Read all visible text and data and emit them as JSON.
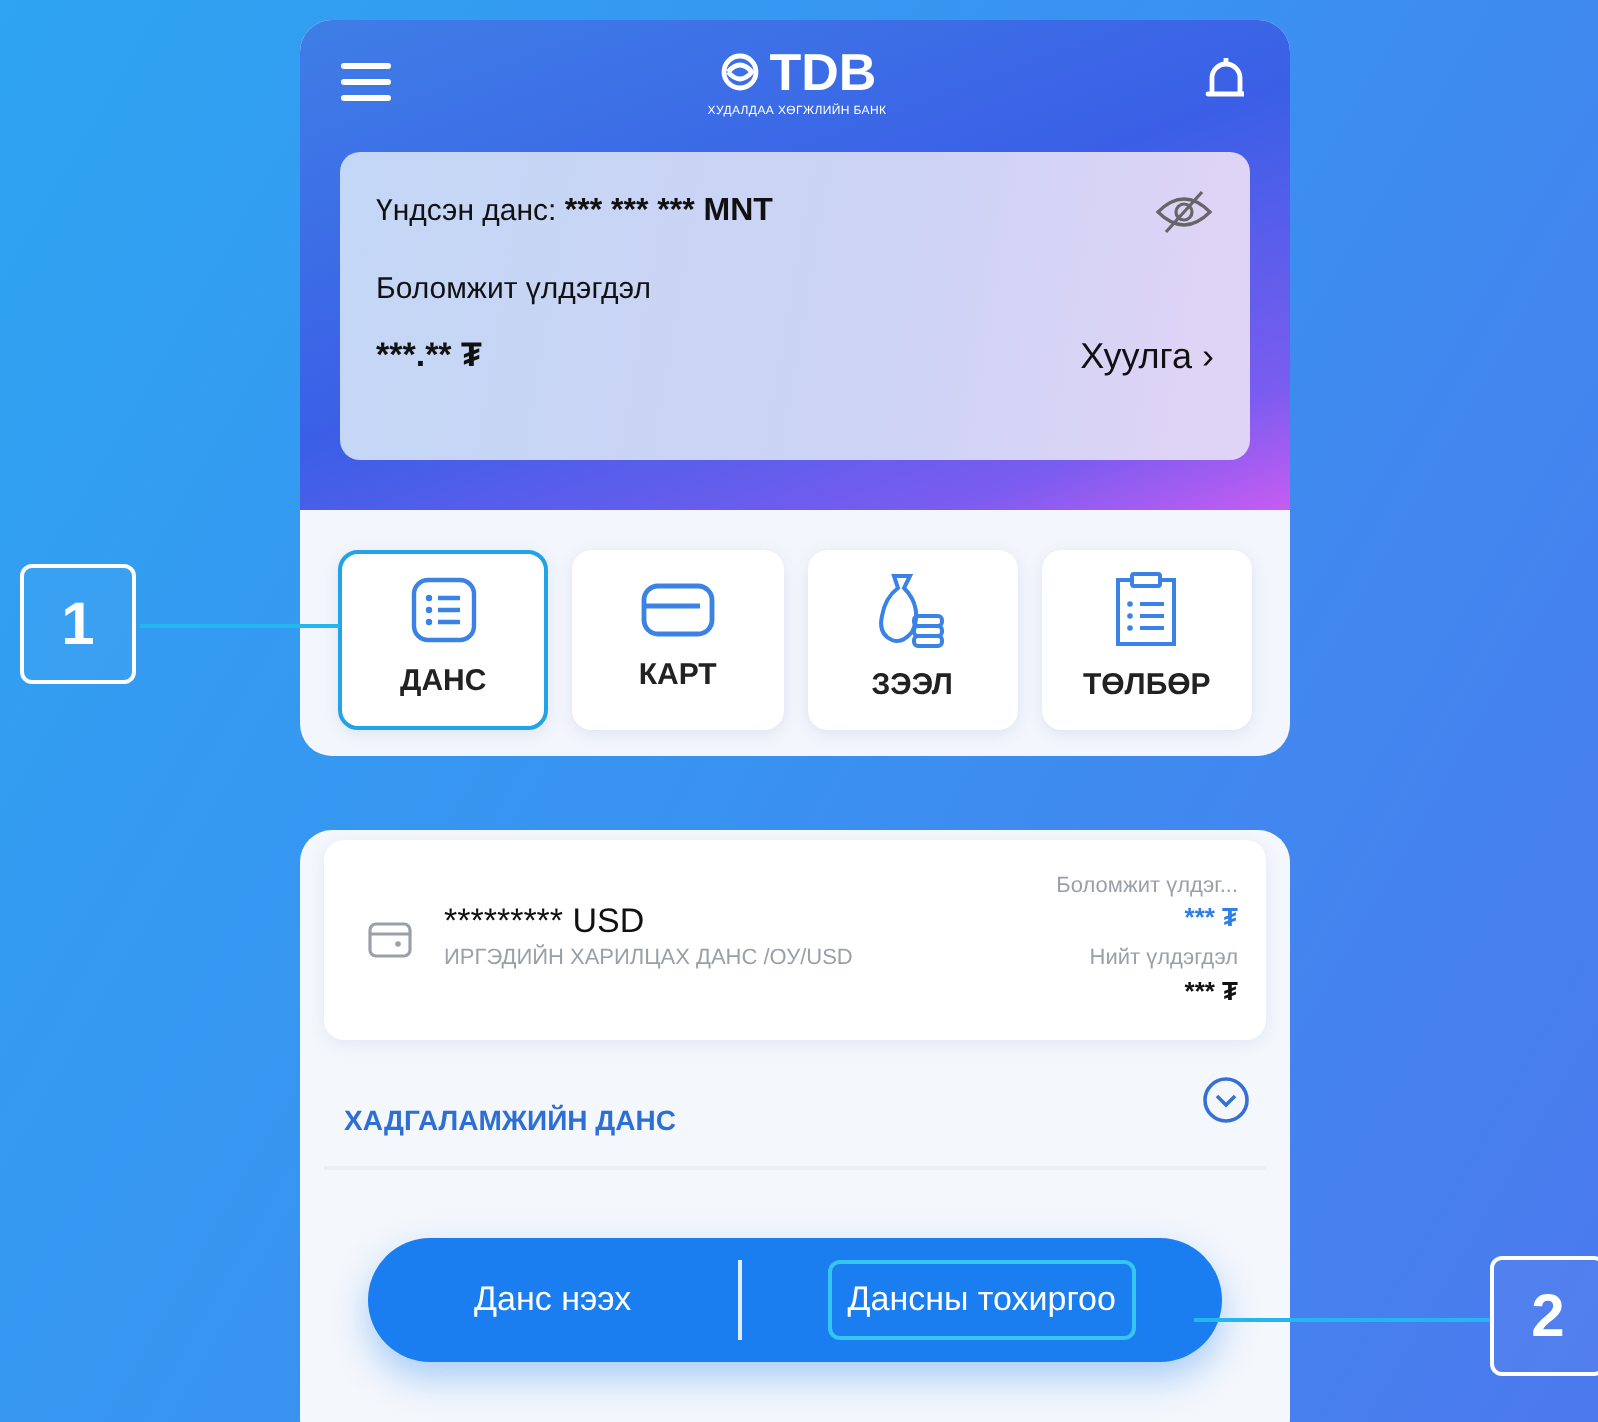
{
  "header": {
    "logo": "TDB",
    "logo_subtitle": "ХУДАЛДАА ХӨГЖЛИЙН БАНК"
  },
  "balance_card": {
    "account_label": "Үндсэн данс:",
    "account_number": "*** *** *** MNT",
    "available_label": "Боломжит үлдэгдэл",
    "available_amount": "***.** ₮",
    "statement_link": "Хуулга",
    "chevron": "›"
  },
  "quick_actions": [
    {
      "label": "ДАНС",
      "kind": "list",
      "highlighted": true
    },
    {
      "label": "КАРТ",
      "kind": "card",
      "highlighted": false
    },
    {
      "label": "ЗЭЭЛ",
      "kind": "loan",
      "highlighted": false
    },
    {
      "label": "ТӨЛБӨР",
      "kind": "payment",
      "highlighted": false
    }
  ],
  "accounts": [
    {
      "number": "********* USD",
      "type": "ИРГЭДИЙН ХАРИЛЦАХ ДАНС /ОУ/USD",
      "available_label": "Боломжит үлдэг...",
      "available_amount": "*** ₮",
      "total_label": "Нийт үлдэгдэл",
      "total_amount": "*** ₮"
    }
  ],
  "sections": [
    {
      "title": "ХАДГАЛАМЖИЙН ДАНС",
      "expanded": false
    }
  ],
  "bottom_bar": [
    {
      "label": "Данс нээх",
      "highlighted": false
    },
    {
      "label": "Дансны тохиргоо",
      "highlighted": true
    }
  ],
  "callouts": [
    {
      "number": "1"
    },
    {
      "number": "2"
    }
  ]
}
